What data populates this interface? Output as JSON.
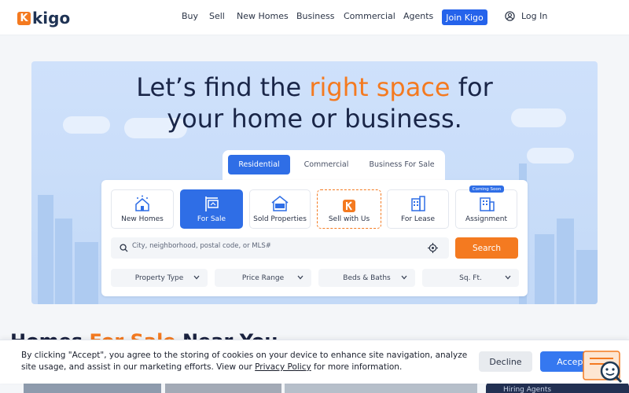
{
  "header": {
    "logo_mark": "K",
    "logo_text": "kigo",
    "nav": [
      "Buy",
      "Sell",
      "New Homes",
      "Business",
      "Commercial",
      "Agents"
    ],
    "join_label": "Join Kigo",
    "login_label": "Log In"
  },
  "hero": {
    "headline_pre": "Let’s find the ",
    "headline_accent": "right space",
    "headline_post": " for",
    "headline_line2": "your home or business."
  },
  "search": {
    "tabs": [
      "Residential",
      "Commercial",
      "Business For Sale"
    ],
    "active_tab": "Residential",
    "categories": [
      {
        "label": "New Homes",
        "icon": "new-homes-icon"
      },
      {
        "label": "For Sale",
        "icon": "for-sale-sign-icon"
      },
      {
        "label": "Sold Properties",
        "icon": "sold-house-icon"
      },
      {
        "label": "Sell with Us",
        "icon": "kigo-logo-icon"
      },
      {
        "label": "For Lease",
        "icon": "lease-building-icon"
      },
      {
        "label": "Assignment",
        "icon": "assignment-building-icon"
      }
    ],
    "active_category": "For Sale",
    "coming_soon_badge": "Coming Soon",
    "placeholder": "City, neighborhood, postal code, or MLS#",
    "search_button": "Search",
    "filters": [
      "Property Type",
      "Price Range",
      "Beds & Baths",
      "Sq. Ft."
    ]
  },
  "section": {
    "title_pre": "Homes ",
    "title_accent": "For Sale",
    "title_post": " Near You"
  },
  "sidebar_card": {
    "label": "Hiring Agents"
  },
  "cookie": {
    "text_before_link": "By clicking \"Accept\", you agree to the storing of cookies on your device to enhance site navigation, analyze site usage, and assist in our marketing efforts. View our ",
    "link_text": "Privacy Policy",
    "text_after_link": " for more information.",
    "decline_label": "Decline",
    "accept_label": "Accept"
  },
  "colors": {
    "brand_orange": "#f47a20",
    "brand_blue": "#2f6ee6",
    "navy": "#1a2648"
  }
}
